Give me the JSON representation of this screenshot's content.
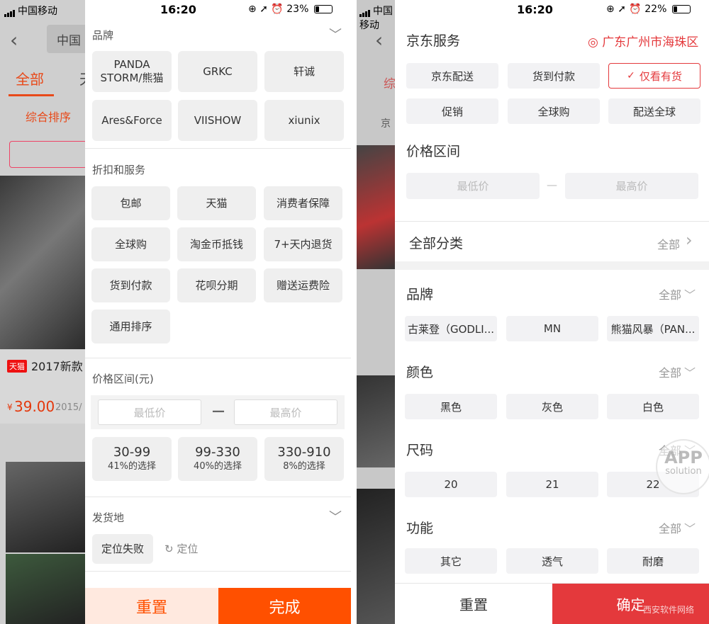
{
  "left_status": {
    "carrier": "中国移动",
    "time": "16:20",
    "battery": "23%",
    "battery_level": 0.23
  },
  "right_status": {
    "carrier": "中国移动",
    "time": "16:20",
    "battery": "22%",
    "battery_level": 0.22
  },
  "left_bg": {
    "search_text": "中国",
    "tab_all": "全部",
    "tab_tian": "天",
    "sort": "综合排序",
    "badge": "天猫",
    "product_title": "2017新款",
    "price_symbol": "¥",
    "price": "39.00",
    "year": "2015/"
  },
  "left_filter": {
    "brand_title": "品牌",
    "brands": [
      "PANDA STORM/熊猫",
      "GRKC",
      "轩诚",
      "Ares&Force",
      "VIISHOW",
      "xiunix"
    ],
    "service_title": "折扣和服务",
    "services": [
      "包邮",
      "天猫",
      "消费者保障",
      "全球购",
      "淘金币抵钱",
      "7+天内退货",
      "货到付款",
      "花呗分期",
      "赠送运费险",
      "通用排序"
    ],
    "price_title": "价格区间(元)",
    "price_min_placeholder": "最低价",
    "price_max_placeholder": "最高价",
    "price_dash": "—",
    "price_ranges": [
      {
        "range": "30-99",
        "pct": "41%的选择"
      },
      {
        "range": "99-330",
        "pct": "40%的选择"
      },
      {
        "range": "330-910",
        "pct": "8%的选择"
      }
    ],
    "ship_title": "发货地",
    "locate_fail": "定位失败",
    "locate": "定位",
    "reset": "重置",
    "done": "完成"
  },
  "right_bg": {
    "tab": "综",
    "search": "京"
  },
  "right_filter": {
    "jd_service_title": "京东服务",
    "location": "广东广州市海珠区",
    "services": [
      "京东配送",
      "货到付款",
      "仅看有货",
      "促销",
      "全球购",
      "配送全球"
    ],
    "price_title": "价格区间",
    "price_min_placeholder": "最低价",
    "price_max_placeholder": "最高价",
    "price_dash": "—",
    "all_category_title": "全部分类",
    "all_label": "全部",
    "brand_title": "品牌",
    "brand_all": "全部",
    "brands": [
      "古莱登（GODLI...",
      "MN",
      "熊猫风暴（PAN..."
    ],
    "color_title": "颜色",
    "color_all": "全部",
    "colors": [
      "黑色",
      "灰色",
      "白色"
    ],
    "size_title": "尺码",
    "size_all": "全部",
    "sizes": [
      "20",
      "21",
      "22"
    ],
    "function_title": "功能",
    "function_all": "全部",
    "functions": [
      "其它",
      "透气",
      "耐磨"
    ],
    "reset": "重置",
    "confirm": "确定",
    "watermark_app": "APP",
    "watermark_solution": "solution",
    "watermark_site": "西安软件网络"
  },
  "colors": {
    "accent_orange": "#ff5000",
    "light_orange": "#ffe9df",
    "jd_red": "#e4393c"
  }
}
